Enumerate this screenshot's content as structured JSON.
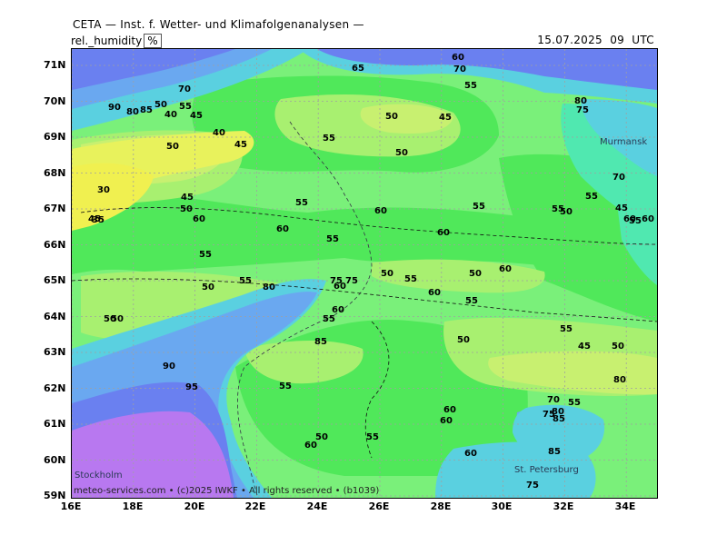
{
  "header": {
    "title": "CETA — Inst. f. Wetter- und Klimafolgenanalysen —",
    "field_name": "rel._humidity",
    "field_unit": "%",
    "timestamp": "15.07.2025  09  UTC"
  },
  "axes": {
    "lat_labels": [
      "71N",
      "70N",
      "69N",
      "68N",
      "67N",
      "66N",
      "65N",
      "64N",
      "63N",
      "62N",
      "61N",
      "60N",
      "59N"
    ],
    "lon_labels": [
      "16E",
      "18E",
      "20E",
      "22E",
      "24E",
      "26E",
      "28E",
      "30E",
      "32E",
      "34E"
    ]
  },
  "cities": {
    "murmansk": "Murmansk",
    "stockholm": "Stockholm",
    "st_petersburg": "St. Petersburg"
  },
  "watermark": "meteo-services.com • (c)2025 IWKF • All rights reserved • (b1039)",
  "colors": {
    "h30": "#f0f050",
    "h40": "#e8f25c",
    "h45": "#c8f070",
    "h50": "#a8f070",
    "h55": "#7af07a",
    "h60": "#50e85a",
    "h70": "#50e8b0",
    "h80": "#5ad0e0",
    "h90": "#6aa8f0",
    "h95": "#6a80f0",
    "h100": "#b878f0",
    "grid": "#a0a0a0"
  },
  "contour_labels": [
    {
      "id": "c1",
      "text": "90"
    },
    {
      "id": "c2",
      "text": "80"
    },
    {
      "id": "c3",
      "text": "85"
    },
    {
      "id": "c4",
      "text": "70"
    },
    {
      "id": "c5",
      "text": "50"
    },
    {
      "id": "c6",
      "text": "55"
    },
    {
      "id": "c7",
      "text": "40"
    },
    {
      "id": "c8",
      "text": "45"
    },
    {
      "id": "c9",
      "text": "40"
    },
    {
      "id": "c10",
      "text": "45"
    },
    {
      "id": "c11",
      "text": "50"
    },
    {
      "id": "c12",
      "text": "35"
    },
    {
      "id": "c13",
      "text": "30"
    },
    {
      "id": "c14",
      "text": "45"
    },
    {
      "id": "c15",
      "text": "50"
    },
    {
      "id": "c16",
      "text": "55"
    },
    {
      "id": "c17",
      "text": "60"
    },
    {
      "id": "c18",
      "text": "60"
    },
    {
      "id": "c19",
      "text": "55"
    },
    {
      "id": "c20",
      "text": "55"
    },
    {
      "id": "c21",
      "text": "50"
    },
    {
      "id": "c22",
      "text": "45"
    },
    {
      "id": "c23",
      "text": "55"
    },
    {
      "id": "c24",
      "text": "50"
    },
    {
      "id": "c25",
      "text": "50"
    },
    {
      "id": "c26",
      "text": "45"
    },
    {
      "id": "c27",
      "text": "60"
    },
    {
      "id": "c28",
      "text": "50"
    },
    {
      "id": "c29",
      "text": "55"
    },
    {
      "id": "c30",
      "text": "60"
    },
    {
      "id": "c31",
      "text": "55"
    },
    {
      "id": "c32",
      "text": "65"
    },
    {
      "id": "c33",
      "text": "60"
    },
    {
      "id": "c34",
      "text": "70"
    },
    {
      "id": "c35",
      "text": "55"
    },
    {
      "id": "c36",
      "text": "80"
    },
    {
      "id": "c37",
      "text": "75"
    },
    {
      "id": "c38",
      "text": "70"
    },
    {
      "id": "c39",
      "text": "55"
    },
    {
      "id": "c40",
      "text": "60"
    },
    {
      "id": "c41",
      "text": "55"
    },
    {
      "id": "c42",
      "text": "60"
    },
    {
      "id": "c43",
      "text": "50"
    },
    {
      "id": "c44",
      "text": "50"
    },
    {
      "id": "c45",
      "text": "60"
    },
    {
      "id": "c46",
      "text": "55"
    },
    {
      "id": "c47",
      "text": "50"
    },
    {
      "id": "c48",
      "text": "55"
    },
    {
      "id": "c49",
      "text": "45"
    },
    {
      "id": "c50",
      "text": "50"
    },
    {
      "id": "c51",
      "text": "80"
    },
    {
      "id": "c52",
      "text": "45"
    },
    {
      "id": "c53",
      "text": "50"
    },
    {
      "id": "c54",
      "text": "55"
    },
    {
      "id": "c55",
      "text": "60"
    },
    {
      "id": "c56",
      "text": "55"
    },
    {
      "id": "c57",
      "text": "85"
    },
    {
      "id": "c58",
      "text": "75"
    },
    {
      "id": "c59",
      "text": "60"
    },
    {
      "id": "c60",
      "text": "80"
    },
    {
      "id": "c61",
      "text": "55"
    },
    {
      "id": "c62",
      "text": "60"
    },
    {
      "id": "c63",
      "text": "55"
    },
    {
      "id": "c64",
      "text": "50"
    },
    {
      "id": "c65",
      "text": "60"
    },
    {
      "id": "c66",
      "text": "75"
    },
    {
      "id": "c67",
      "text": "55"
    },
    {
      "id": "c68",
      "text": "90"
    },
    {
      "id": "c69",
      "text": "95"
    },
    {
      "id": "c70",
      "text": "80"
    },
    {
      "id": "c71",
      "text": "85"
    },
    {
      "id": "c72",
      "text": "75"
    },
    {
      "id": "c73",
      "text": "70"
    },
    {
      "id": "c74",
      "text": "85"
    },
    {
      "id": "c75",
      "text": "75"
    },
    {
      "id": "c76",
      "text": "60"
    },
    {
      "id": "c77",
      "text": "50"
    },
    {
      "id": "c78",
      "text": "60"
    },
    {
      "id": "c79",
      "text": "60"
    },
    {
      "id": "c80",
      "text": "55"
    }
  ]
}
